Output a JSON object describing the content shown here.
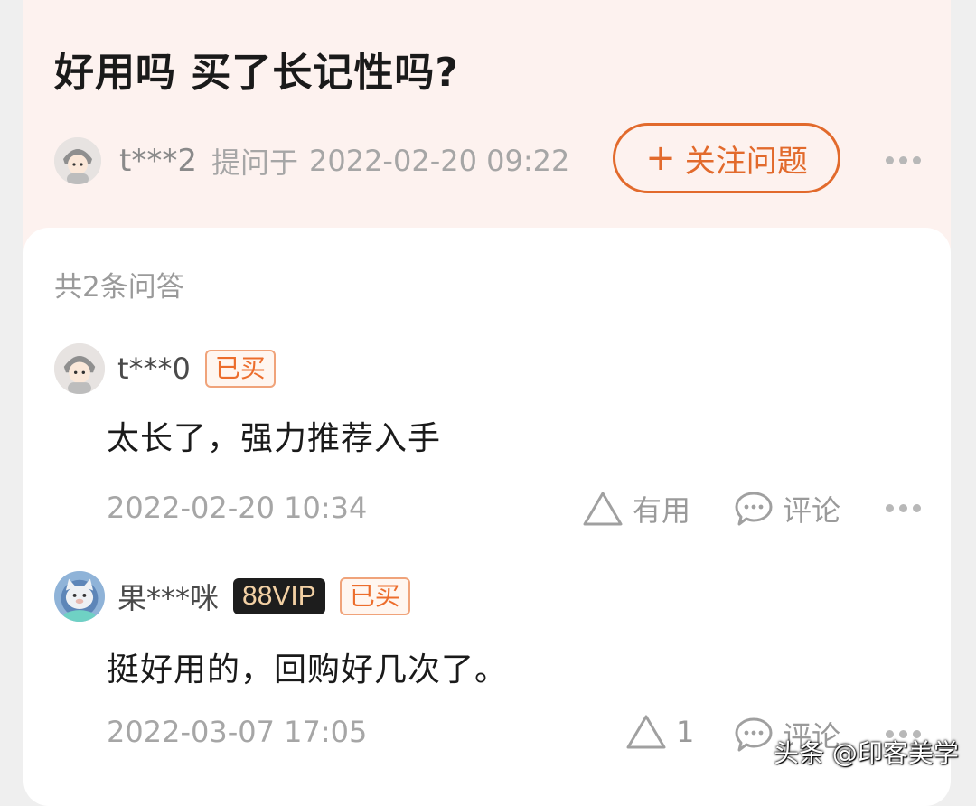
{
  "question": {
    "title": "好用吗 买了长记性吗?",
    "asker": "t***2",
    "asked_label": "提问于",
    "asked_time": "2022-02-20 09:22",
    "follow_button": "关注问题",
    "follow_icon": "plus-icon"
  },
  "answers_count": "共2条问答",
  "answers": [
    {
      "user": "t***0",
      "badge_bought": "已买",
      "text": "太长了，强力推荐入手",
      "time": "2022-02-20 10:34",
      "useful_label": "有用",
      "comment_label": "评论"
    },
    {
      "user": "果***咪",
      "badge_vip": "88VIP",
      "badge_bought": "已买",
      "text": "挺好用的，回购好几次了。",
      "time": "2022-03-07 17:05",
      "useful_count": "1",
      "comment_label": "评论"
    }
  ],
  "watermark": "头条 @印客美学",
  "colors": {
    "accent": "#e26a2c",
    "header_bg": "#fdf2ef",
    "vip_bg": "#1d1d1d"
  }
}
